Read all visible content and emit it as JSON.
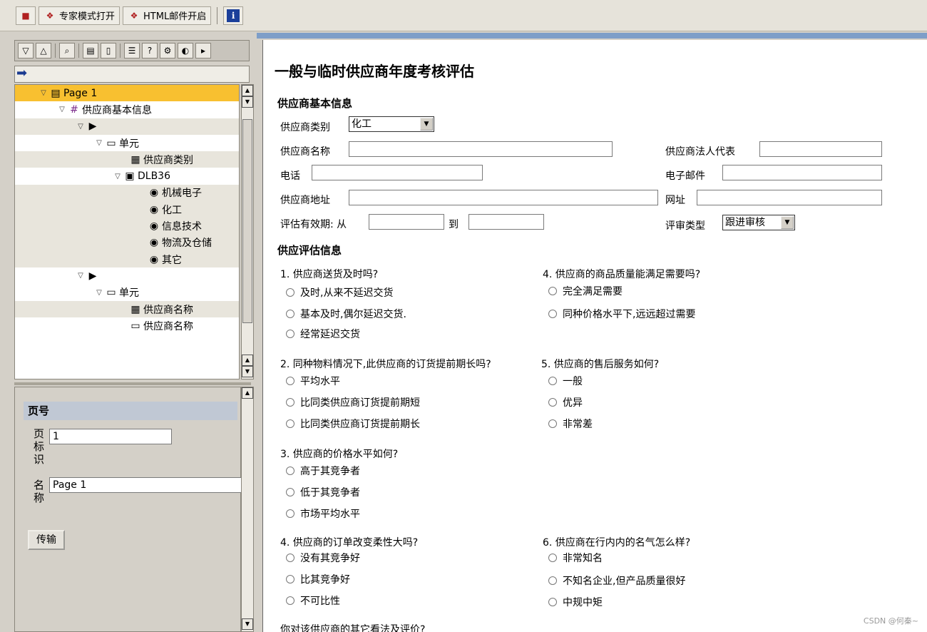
{
  "toolbar": {
    "expert_label": "专家模式打开",
    "html_mail_label": "HTML邮件开启"
  },
  "tree": {
    "rows": [
      {
        "label": "Page 1"
      },
      {
        "label": "供应商基本信息"
      },
      {
        "label": ""
      },
      {
        "label": "单元"
      },
      {
        "label": "供应商类别"
      },
      {
        "label": "DLB36"
      },
      {
        "label": "机械电子"
      },
      {
        "label": "化工"
      },
      {
        "label": "信息技术"
      },
      {
        "label": "物流及仓储"
      },
      {
        "label": "其它"
      },
      {
        "label": ""
      },
      {
        "label": "单元"
      },
      {
        "label": "供应商名称"
      },
      {
        "label": "供应商名称"
      }
    ]
  },
  "props": {
    "header": "页号",
    "page_id_label": "页标识",
    "page_id_value": "1",
    "name_label": "名称",
    "name_value": "Page 1",
    "transfer_label": "传输"
  },
  "form": {
    "title": "一般与临时供应商年度考核评估",
    "basic_section": "供应商基本信息",
    "category_label": "供应商类别",
    "category_value": "化工",
    "name_label": "供应商名称",
    "legal_rep_label": "供应商法人代表",
    "phone_label": "电话",
    "email_label": "电子邮件",
    "address_label": "供应商地址",
    "website_label": "网址",
    "validity_label": "评估有效期: 从",
    "to_label": "到",
    "review_type_label": "评审类型",
    "review_type_value": "跟进审核",
    "eval_section": "供应评估信息",
    "questions": [
      {
        "title": "1. 供应商送货及时吗?",
        "options": [
          "及时,从来不延迟交货",
          "基本及时,偶尔延迟交货.",
          "经常延迟交货"
        ]
      },
      {
        "title": "4. 供应商的商品质量能满足需要吗?",
        "options": [
          "完全满足需要",
          "同种价格水平下,远远超过需要"
        ]
      },
      {
        "title": "2. 同种物料情况下,此供应商的订货提前期长吗?",
        "options": [
          "平均水平",
          "比同类供应商订货提前期短",
          "比同类供应商订货提前期长"
        ]
      },
      {
        "title": "5. 供应商的售后服务如何?",
        "options": [
          "一般",
          "优异",
          "非常差"
        ]
      },
      {
        "title": "3. 供应商的价格水平如何?",
        "options": [
          "高于其竞争者",
          "低于其竞争者",
          "市场平均水平"
        ]
      },
      {
        "title": "4. 供应商的订单改变柔性大吗?",
        "options": [
          "没有其竞争好",
          "比其竞争好",
          "不可比性"
        ]
      },
      {
        "title": "6. 供应商在行内内的名气怎么样?",
        "options": [
          "非常知名",
          "不知名企业,但产品质量很好",
          "中规中矩"
        ]
      }
    ],
    "final_question": "你对该供应商的其它看法及评价?"
  },
  "watermark": "CSDN @何秦~"
}
